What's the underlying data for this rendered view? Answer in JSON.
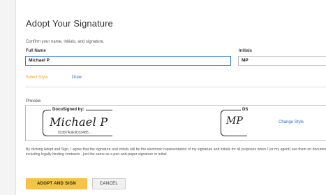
{
  "dialog": {
    "title": "Adopt Your Signature",
    "subtitle": "Confirm your name, initials, and signature."
  },
  "form": {
    "full_name_label": "Full Name",
    "full_name_value": "Michael P",
    "initials_label": "Initials",
    "initials_value": "MP"
  },
  "tabs": [
    {
      "label": "Select Style",
      "active": true
    },
    {
      "label": "Draw",
      "active": false
    }
  ],
  "preview": {
    "label": "Preview",
    "signature_header": "DocuSigned by:",
    "signature_text": "Michael P",
    "signature_id": "02367A3E9D33485...",
    "initials_header": "DS",
    "initials_text": "MP",
    "change_style_label": "Change Style"
  },
  "disclaimer": "By clicking Adopt and Sign, I agree that the signature and initials will be the electronic representation of my signature and initials for all purposes when I (or my agent) use them on documents, including legally binding contracts - just the same as a pen-and-paper signature or initial.",
  "buttons": {
    "adopt_label": "ADOPT AND SIGN",
    "cancel_label": "CANCEL"
  },
  "colors": {
    "accent_tab": "#f5a623",
    "link": "#2b6fc2",
    "primary_button": "#f6c344",
    "focus_border": "#2b7bd6"
  }
}
